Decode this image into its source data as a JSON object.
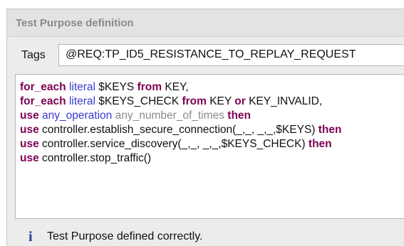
{
  "panel": {
    "title": "Test Purpose definition"
  },
  "tags": {
    "label": "Tags",
    "value": "@REQ:TP_ID5_RESISTANCE_TO_REPLAY_REQUEST"
  },
  "code": {
    "lines": [
      [
        {
          "t": "for_each",
          "s": "kw"
        },
        {
          "t": " ",
          "s": "pl"
        },
        {
          "t": "literal",
          "s": "lit"
        },
        {
          "t": " $KEYS ",
          "s": "pl"
        },
        {
          "t": "from",
          "s": "kw"
        },
        {
          "t": " KEY,",
          "s": "pl"
        }
      ],
      [
        {
          "t": "for_each",
          "s": "kw"
        },
        {
          "t": " ",
          "s": "pl"
        },
        {
          "t": "literal",
          "s": "lit"
        },
        {
          "t": " $KEYS_CHECK ",
          "s": "pl"
        },
        {
          "t": "from",
          "s": "kw"
        },
        {
          "t": " KEY ",
          "s": "pl"
        },
        {
          "t": "or",
          "s": "kw"
        },
        {
          "t": " KEY_INVALID,",
          "s": "pl"
        }
      ],
      [
        {
          "t": "use",
          "s": "kw"
        },
        {
          "t": " ",
          "s": "pl"
        },
        {
          "t": "any_operation",
          "s": "lit"
        },
        {
          "t": " ",
          "s": "pl"
        },
        {
          "t": "any_number_of_times",
          "s": "gr"
        },
        {
          "t": " ",
          "s": "pl"
        },
        {
          "t": "then",
          "s": "kw"
        }
      ],
      [
        {
          "t": "use",
          "s": "kw"
        },
        {
          "t": " controller.establish_secure_connection(_,_, _,_,$KEYS) ",
          "s": "pl"
        },
        {
          "t": "then",
          "s": "kw"
        }
      ],
      [
        {
          "t": "use",
          "s": "kw"
        },
        {
          "t": " controller.service_discovery(_,_, _,_,$KEYS_CHECK) ",
          "s": "pl"
        },
        {
          "t": "then",
          "s": "kw"
        }
      ],
      [
        {
          "t": "use",
          "s": "kw"
        },
        {
          "t": " controller.stop_traffic()",
          "s": "pl"
        }
      ]
    ]
  },
  "status": {
    "icon": "info-icon",
    "icon_glyph": "i",
    "message": "Test Purpose defined correctly."
  },
  "colors": {
    "keyword": "#7f0055",
    "literal": "#3a3ad2",
    "plain": "#111111",
    "gray": "#8a8a8a",
    "info_icon": "#1f3f8f"
  }
}
